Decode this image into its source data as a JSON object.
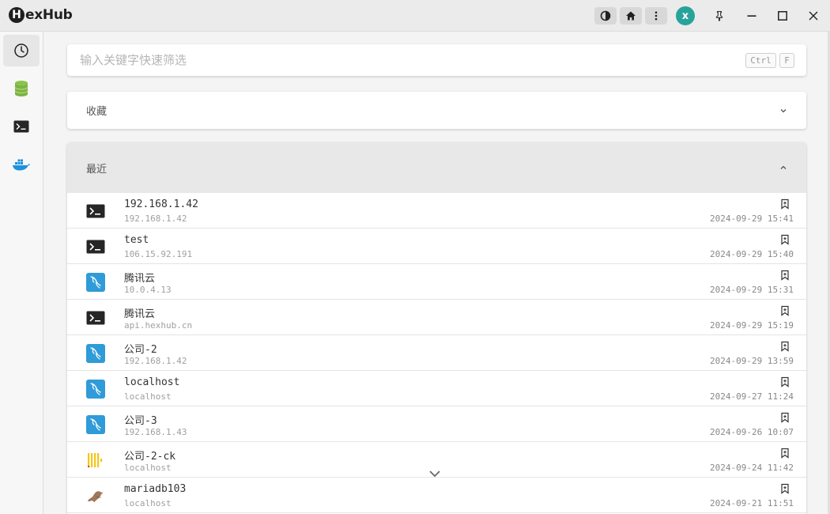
{
  "app": {
    "logo_letter": "H",
    "logo_rest": "exHub"
  },
  "titlebar": {
    "avatar_initial": "x"
  },
  "search": {
    "placeholder": "输入关键字快速筛选",
    "kbd_ctrl": "Ctrl",
    "kbd_f": "F"
  },
  "favorites": {
    "title": "收藏"
  },
  "recent": {
    "title": "最近",
    "items": [
      {
        "type": "terminal",
        "name": "192.168.1.42",
        "host": "192.168.1.42",
        "time": "2024-09-29 15:41"
      },
      {
        "type": "terminal",
        "name": "test",
        "host": "106.15.92.191",
        "time": "2024-09-29 15:40"
      },
      {
        "type": "mysql",
        "name": "腾讯云",
        "host": "10.0.4.13",
        "time": "2024-09-29 15:31"
      },
      {
        "type": "terminal",
        "name": "腾讯云",
        "host": "api.hexhub.cn",
        "time": "2024-09-29 15:19"
      },
      {
        "type": "mysql",
        "name": "公司-2",
        "host": "192.168.1.42",
        "time": "2024-09-29 13:59"
      },
      {
        "type": "mysql",
        "name": "localhost",
        "host": "localhost",
        "time": "2024-09-27 11:24"
      },
      {
        "type": "mysql",
        "name": "公司-3",
        "host": "192.168.1.43",
        "time": "2024-09-26 10:07"
      },
      {
        "type": "clickhouse",
        "name": "公司-2-ck",
        "host": "localhost",
        "time": "2024-09-24 11:42"
      },
      {
        "type": "mariadb",
        "name": "mariadb103",
        "host": "localhost",
        "time": "2024-09-21 11:51"
      }
    ]
  },
  "colors": {
    "accent": "#29a39a",
    "mysql": "#2f9bd8",
    "terminal": "#262626",
    "clickhouse": "#f5c518",
    "mariadb": "#a0775a",
    "database": "#7cb342",
    "docker": "#1d91e0"
  },
  "icons": [
    "theme-toggle-icon",
    "home-icon",
    "more-vert-icon",
    "pin-icon",
    "minimize-icon",
    "maximize-icon",
    "close-icon",
    "history-icon",
    "database-icon",
    "terminal-icon",
    "docker-icon",
    "chevron-down-icon",
    "chevron-up-icon",
    "bookmark-icon"
  ]
}
